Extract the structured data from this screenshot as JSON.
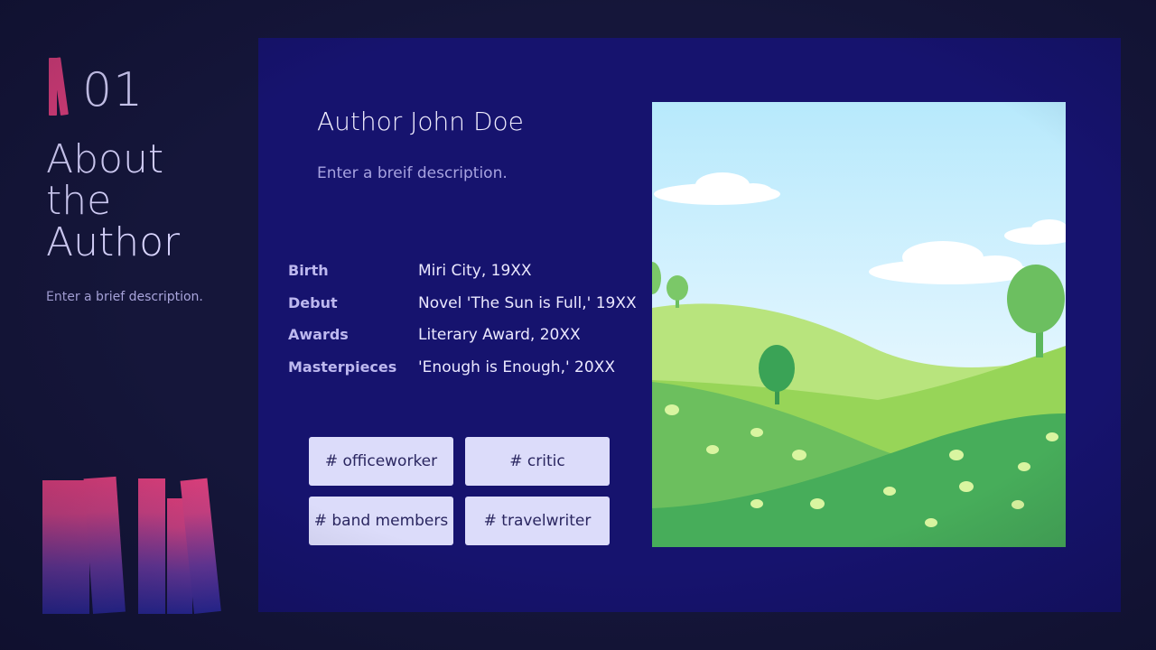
{
  "section": {
    "number": "01",
    "title_lines": [
      "About",
      "the",
      "Author"
    ],
    "description": "Enter a brief description."
  },
  "panel": {
    "author_name": "Author John Doe",
    "description": "Enter a breif description.",
    "info": [
      {
        "label": "Birth",
        "value": "Miri City, 19XX"
      },
      {
        "label": "Debut",
        "value": "Novel 'The Sun is Full,' 19XX"
      },
      {
        "label": "Awards",
        "value": "Literary Award, 20XX"
      },
      {
        "label": "Masterpieces",
        "value": "'Enough is Enough,' 20XX"
      }
    ],
    "tags": [
      "# officeworker",
      "# critic",
      "# band members",
      "# travelwriter"
    ]
  },
  "colors": {
    "background": "#15163a",
    "panel": "#16136e",
    "accent_pink": "#e0407e",
    "tag_bg": "#dcdcfa"
  },
  "icons": [
    "books-logo-icon",
    "books-decoration-icon",
    "landscape-illustration"
  ]
}
